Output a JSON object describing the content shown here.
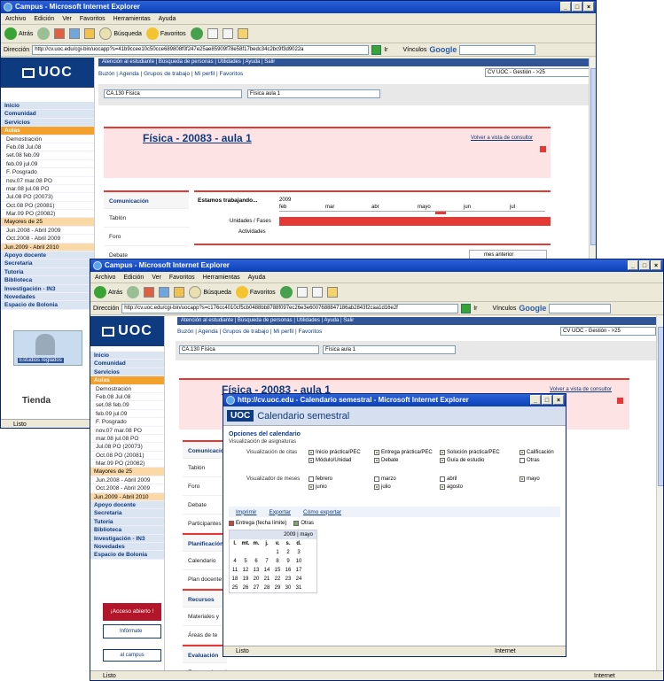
{
  "browser": {
    "title": "Campus - Microsoft Internet Explorer",
    "menu": [
      "Archivo",
      "Edición",
      "Ver",
      "Favoritos",
      "Herramientas",
      "Ayuda"
    ],
    "toolbar": {
      "back": "Atrás",
      "search": "Búsqueda",
      "favorites": "Favoritos"
    },
    "address_label": "Dirección",
    "address_back": "http://cv.uoc.edu/cgi-bin/uocapp?s=41b9ccee10c50cce689808f0f247e25ae85909f78e58f17bedc34c2bc9f3d9022a",
    "address_front": "http://cv.uoc.edu/cgi-bin/uocapp?s=c176cc4010cf5cb0488bb8788f097ec26e3e6007688847186ab2843f2caa1d16e2f",
    "go_label": "Ir",
    "links_label": "Vínculos",
    "google": "Google",
    "status": "Listo",
    "zone": "Internet"
  },
  "campus": {
    "logo": "UOC",
    "top_links": "Atención al estudiante | Búsqueda de personas | Utilidades | Ayuda | Salir",
    "main_links": "Buzón | Agenda | Grupos de trabajo | Mi perfil | Favoritos",
    "cv_select": "CV UOC - Gestión - >25",
    "course_select": "CA.130 Física",
    "aula_select": "Física aula 1",
    "page_title": "Física - 20083 - aula 1",
    "volver": "Volver a vista de consultor",
    "nav": [
      {
        "label": "Inicio",
        "kind": "sec"
      },
      {
        "label": "Comunidad",
        "kind": "sec"
      },
      {
        "label": "Servicios",
        "kind": "sec"
      },
      {
        "label": "Aulas",
        "kind": "sel"
      },
      {
        "label": "Demostración",
        "kind": "sub"
      },
      {
        "label": "Feb.08 Jul.08",
        "kind": "sub"
      },
      {
        "label": "set.08 feb.09",
        "kind": "sub"
      },
      {
        "label": "feb.09 jul.09",
        "kind": "sub"
      },
      {
        "label": "F. Posgrado",
        "kind": "sub"
      },
      {
        "label": "nov.07 mar.08 PO",
        "kind": "sub"
      },
      {
        "label": "mar.08 jul.08 PO",
        "kind": "sub"
      },
      {
        "label": "Jul.08 PO (20073)",
        "kind": "sub"
      },
      {
        "label": "Oct.08 PO (20081)",
        "kind": "sub"
      },
      {
        "label": "Mar.09 PO (20082)",
        "kind": "sub"
      },
      {
        "label": "Mayores de 25",
        "kind": "hl"
      },
      {
        "label": "Jun.2008 - Abril 2009",
        "kind": "sub"
      },
      {
        "label": "Oct.2008 - Abril 2009",
        "kind": "sub"
      },
      {
        "label": "Jun.2009 - Abril 2010",
        "kind": "hl"
      },
      {
        "label": "Apoyo docente",
        "kind": "sec"
      },
      {
        "label": "Secretaría",
        "kind": "sec"
      },
      {
        "label": "Tutoría",
        "kind": "sec"
      },
      {
        "label": "Biblioteca",
        "kind": "sec"
      },
      {
        "label": "Investigación - IN3",
        "kind": "sec"
      },
      {
        "label": "Novedades",
        "kind": "sec"
      },
      {
        "label": "Espacio de Bolonia",
        "kind": "sec"
      }
    ],
    "estudios_reglados": "Estudios reglados",
    "tienda": "Tienda",
    "acceso_abierto": "¡Acceso abierto !",
    "informate": "Infórmate",
    "al_campus": "al campus",
    "tabs": [
      "Comunicación",
      "Tablón",
      "Foro",
      "Debate",
      "Participantes del aula"
    ],
    "tabs_front": [
      "Comunicación",
      "Tablón",
      "Foro",
      "Debate",
      "Participantes",
      "Planificación",
      "Calendario",
      "Plan docente",
      "Recursos",
      "Materiales y",
      "Áreas de te",
      "Evaluación",
      "Entrega de actividades"
    ],
    "estamos": "Estamos trabajando...",
    "timeline_year": "2009",
    "timeline_months": [
      "feb",
      "mar",
      "abr",
      "mayo",
      "jun",
      "jul"
    ],
    "unidades": "Unidades / Fases",
    "actividades": "Actividades",
    "mes_anterior": "mes anterior"
  },
  "popup": {
    "title": "http://cv.uoc.edu - Calendario semestral - Microsoft Internet Explorer",
    "logo": "UOC",
    "heading": "Calendario semestral",
    "options_title": "Opciones del calendario",
    "options_sub": "Visualización de asignaturas",
    "citas_label": "Visualización de citas",
    "citas": [
      {
        "label": "Inicio práctica/PEC",
        "on": true
      },
      {
        "label": "Entrega práctica/PEC",
        "on": true
      },
      {
        "label": "Solución práctica/PEC",
        "on": true
      },
      {
        "label": "Calificación",
        "on": true
      },
      {
        "label": "Módulo/Unidad",
        "on": true
      },
      {
        "label": "Debate",
        "on": true
      },
      {
        "label": "Guía de estudio",
        "on": true
      },
      {
        "label": "Otras",
        "on": false
      }
    ],
    "meses_label": "Visualizador de meses",
    "meses": [
      {
        "label": "febrero",
        "on": false
      },
      {
        "label": "marzo",
        "on": false
      },
      {
        "label": "abril",
        "on": false
      },
      {
        "label": "mayo",
        "on": true
      },
      {
        "label": "junio",
        "on": true
      },
      {
        "label": "julio",
        "on": true
      },
      {
        "label": "agosto",
        "on": true
      }
    ],
    "actions": [
      "Imprimir",
      "Exportar",
      "Cómo exportar"
    ],
    "legend": [
      "Entrega (fecha límite)",
      "Otras"
    ],
    "month_header": "2009 | mayo",
    "weekdays": [
      "l.",
      "mt.",
      "m.",
      "j.",
      "v.",
      "s.",
      "d."
    ],
    "weeks": [
      [
        "",
        "",
        "",
        "",
        "1",
        "2",
        "3"
      ],
      [
        "4",
        "5",
        "6",
        "7",
        "8",
        "9",
        "10"
      ],
      [
        "11",
        "12",
        "13",
        "14",
        "15",
        "16",
        "17"
      ],
      [
        "18",
        "19",
        "20",
        "21",
        "22",
        "23",
        "24"
      ],
      [
        "25",
        "26",
        "27",
        "28",
        "29",
        "30",
        "31"
      ]
    ],
    "status": "Listo",
    "zone": "Internet"
  }
}
